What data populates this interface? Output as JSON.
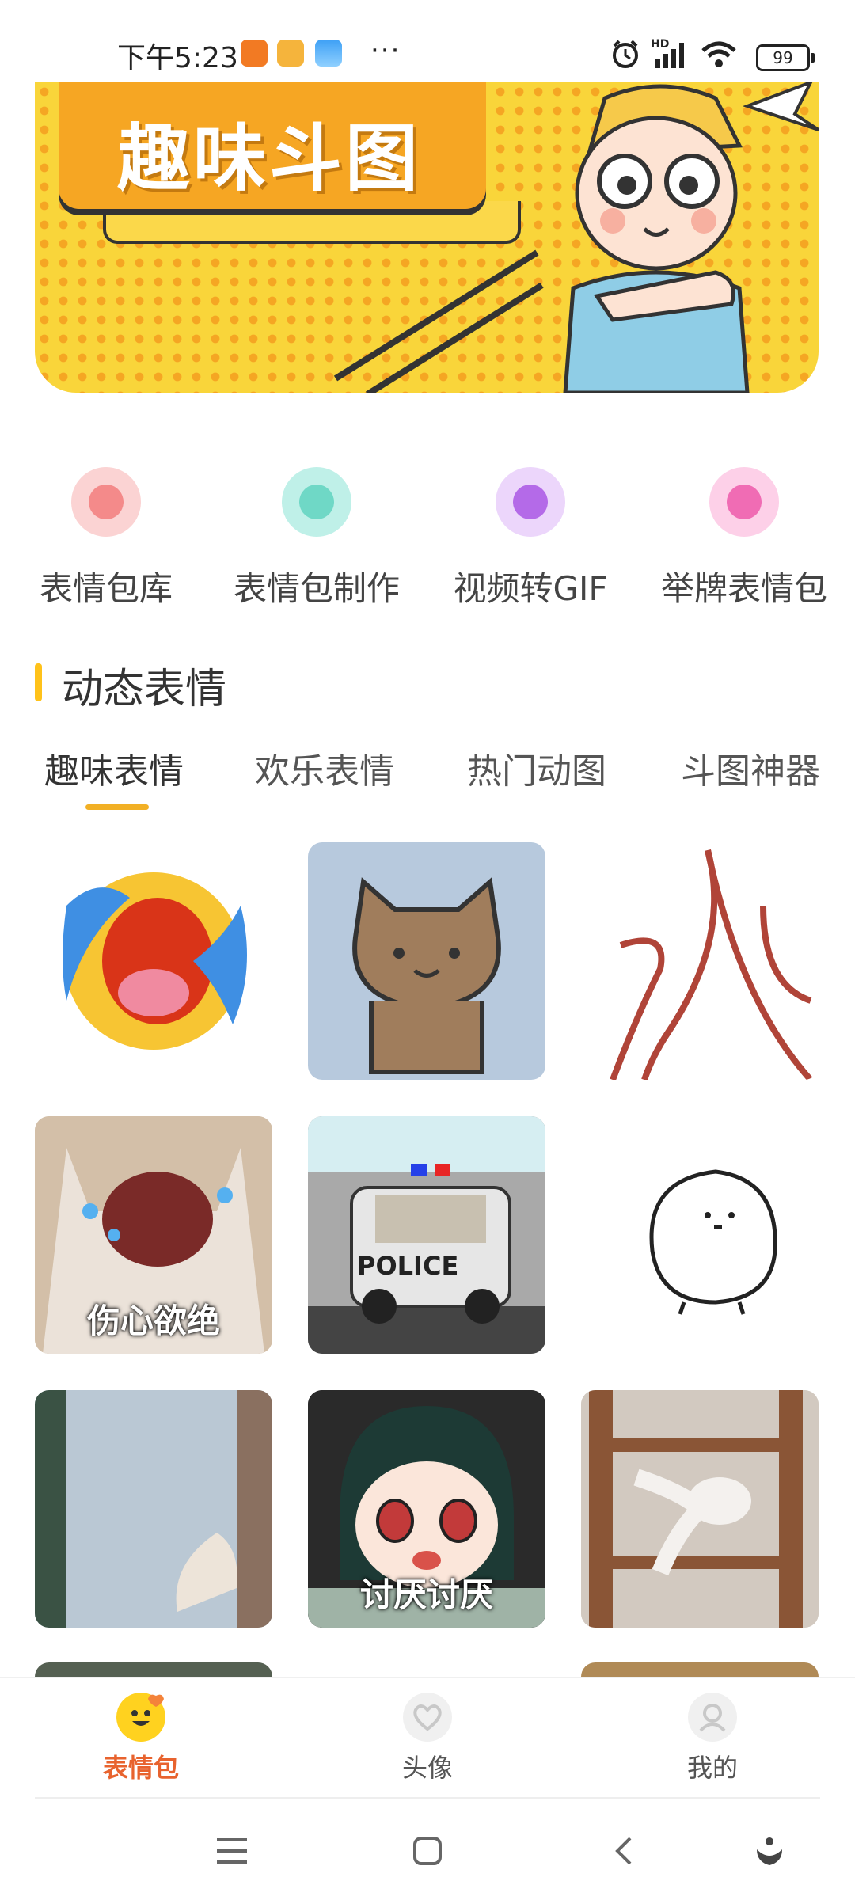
{
  "status_bar": {
    "time": "下午5:23",
    "dots": "···",
    "battery": "99",
    "network": "HD"
  },
  "banner": {
    "title": "趣味斗图"
  },
  "quick_entries": [
    {
      "label": "表情包库",
      "icon": "smile-icon",
      "color": "#fbd3d3",
      "accent": "#f48a8a"
    },
    {
      "label": "表情包制作",
      "icon": "widgets-icon",
      "color": "#bff0e8",
      "accent": "#6fd8c6"
    },
    {
      "label": "视频转GIF",
      "icon": "video-icon",
      "color": "#ecd6fb",
      "accent": "#b46ae8"
    },
    {
      "label": "举牌表情包",
      "icon": "magic-wand-icon",
      "color": "#fdd0e8",
      "accent": "#f06cb4"
    }
  ],
  "section": {
    "title": "动态表情"
  },
  "tabs": [
    {
      "label": "趣味表情",
      "active": true
    },
    {
      "label": "欢乐表情",
      "active": false
    },
    {
      "label": "热门动图",
      "active": false
    },
    {
      "label": "斗图神器",
      "active": false
    }
  ],
  "grid": [
    {
      "name": "crying-emoji",
      "caption": ""
    },
    {
      "name": "brown-cat-sticker",
      "caption": ""
    },
    {
      "name": "red-line-drawing",
      "caption": ""
    },
    {
      "name": "crying-cat",
      "caption": "伤心欲绝"
    },
    {
      "name": "police-car-cat",
      "caption": ""
    },
    {
      "name": "white-blob-bird",
      "caption": ""
    },
    {
      "name": "cat-paw-door",
      "caption": ""
    },
    {
      "name": "anime-girl-angry",
      "caption": "讨厌讨厌"
    },
    {
      "name": "cat-under-chair",
      "caption": ""
    }
  ],
  "police_text": "POLICE",
  "bottom_nav": [
    {
      "label": "表情包",
      "icon": "emoji-face-icon",
      "active": true
    },
    {
      "label": "头像",
      "icon": "heart-avatar-icon",
      "active": false
    },
    {
      "label": "我的",
      "icon": "profile-icon",
      "active": false
    }
  ],
  "colors": {
    "accent": "#f2b025",
    "active_nav": "#e8632e",
    "section_bar": "#ffc21a"
  }
}
